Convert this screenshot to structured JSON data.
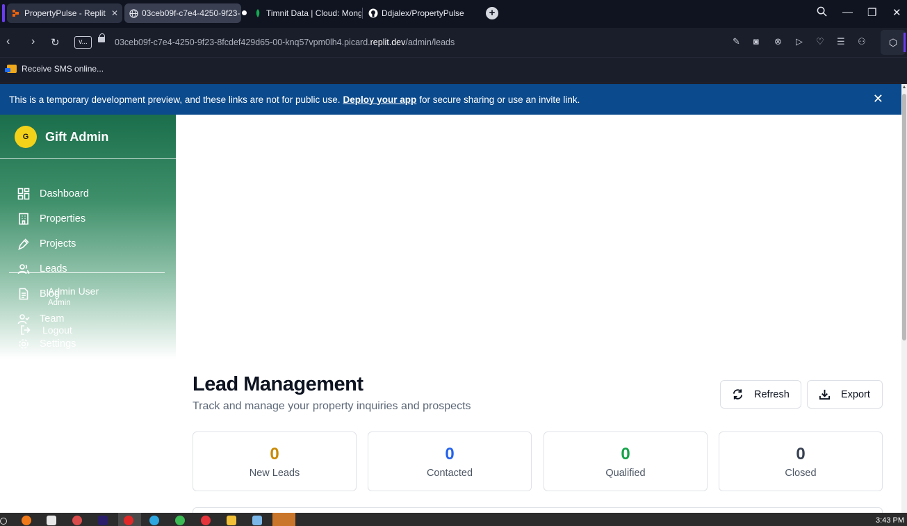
{
  "browser": {
    "tabs": [
      {
        "title": "PropertyPulse - Replit",
        "icon": "replit-icon",
        "active": true
      },
      {
        "title": "03ceb09f-c7e4-4250-9f23-",
        "icon": "globe-icon",
        "active": false
      },
      {
        "title": "Timnit Data | Cloud: Mong",
        "icon": "mongodb-leaf-icon",
        "active": false
      },
      {
        "title": "Ddjalex/PropertyPulse",
        "icon": "github-icon",
        "active": false
      }
    ],
    "address": {
      "version_badge": "v...",
      "url_prefix": "03ceb09f-c7e4-4250-9f23-8fcdef429d65-00-knq57vpm0lh4.picard.",
      "url_host": "replit.dev",
      "url_path": "/admin/leads"
    },
    "bookmarks": [
      {
        "label": "Receive SMS online..."
      }
    ]
  },
  "dev_banner": {
    "text_before": "This is a temporary development preview, and these links are not for public use.",
    "link_label": "Deploy your app",
    "text_after": "for secure sharing or use an invite link."
  },
  "sidebar": {
    "logo_letter": "G",
    "brand": "Gift Admin",
    "items": [
      {
        "label": "Dashboard",
        "icon": "dashboard-icon"
      },
      {
        "label": "Properties",
        "icon": "building-icon"
      },
      {
        "label": "Projects",
        "icon": "hammer-icon"
      },
      {
        "label": "Leads",
        "icon": "users-icon"
      },
      {
        "label": "Blog",
        "icon": "document-icon"
      },
      {
        "label": "Team",
        "icon": "user-check-icon"
      },
      {
        "label": "Settings",
        "icon": "gear-icon"
      }
    ],
    "user": {
      "name": "Admin User",
      "role": "Admin"
    },
    "logout_label": "Logout"
  },
  "main": {
    "title": "Lead Management",
    "subtitle": "Track and manage your property inquiries and prospects",
    "refresh_label": "Refresh",
    "export_label": "Export",
    "stats": [
      {
        "value": "0",
        "label": "New Leads",
        "color": "#ca8a04"
      },
      {
        "value": "0",
        "label": "Contacted",
        "color": "#2563eb"
      },
      {
        "value": "0",
        "label": "Qualified",
        "color": "#16a34a"
      },
      {
        "value": "0",
        "label": "Closed",
        "color": "#374151"
      }
    ]
  },
  "taskbar": {
    "clock": "3:43 PM"
  },
  "colors": {
    "banner": "#0b4a8c",
    "sidebar_top": "#1b6e4b",
    "logo": "#f4d21a"
  }
}
